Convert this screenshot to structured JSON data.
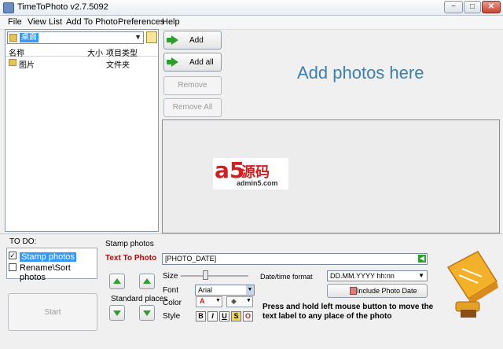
{
  "window": {
    "title": "TimeToPhoto v2.7.5092",
    "min_glyph": "−",
    "max_glyph": "□",
    "close_glyph": "✕"
  },
  "menu": [
    "File",
    "View",
    "List",
    "Add To Photo",
    "Preferences",
    "Help"
  ],
  "browser": {
    "path": "桌面",
    "columns": [
      "名称",
      "大小",
      "项目类型"
    ],
    "items": [
      {
        "name": "图片",
        "size": "",
        "type": "文件夹"
      }
    ]
  },
  "actions": {
    "add": "Add",
    "add_all": "Add all",
    "remove": "Remove",
    "remove_all": "Remove All"
  },
  "hint_add": "Add photos here",
  "watermark": {
    "logo_char": "a5",
    "logo_cn": "源码",
    "logo_url": "admin5.com"
  },
  "todo": {
    "label": "TO DO:",
    "items": [
      {
        "label": "Stamp photos",
        "checked": true,
        "selected": true
      },
      {
        "label": "Rename\\Sort photos",
        "checked": false,
        "selected": false
      }
    ],
    "start": "Start"
  },
  "stamp": {
    "section_title": "Stamp photos",
    "text_label": "Text To Photo",
    "text_value": "[PHOTO_DATE]",
    "standard_places": "Standard places",
    "size_label": "Size",
    "size_level": 0.35,
    "font_label": "Font",
    "font_value": "Arial",
    "color_label": "Color",
    "style_label": "Style",
    "style_buttons": [
      "B",
      "I",
      "U",
      "S",
      "O"
    ],
    "datetime_label": "Date/time format",
    "datetime_value": "DD.MM.YYYY hh:nn",
    "include_date": "Include Photo Date",
    "instructions": "Press and hold left mouse button to move the text label to any place of the photo"
  },
  "colors": {
    "accent_blue": "#3d80ad",
    "selection": "#3399ff",
    "green_arrow": "#2e9e2e",
    "label_red": "#a01010"
  }
}
